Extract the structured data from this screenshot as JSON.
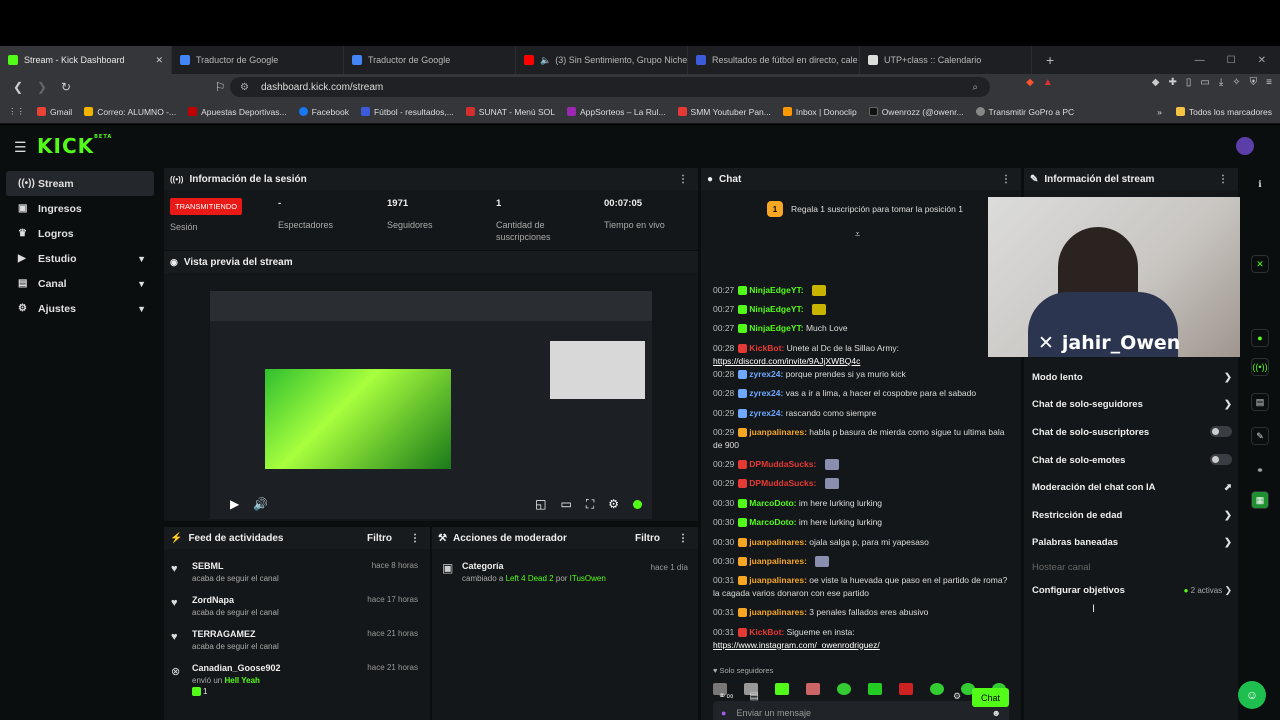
{
  "browser": {
    "tabs": [
      {
        "label": "Stream - Kick Dashboard",
        "color": "#53fc18",
        "active": true
      },
      {
        "label": "Traductor de Google",
        "color": "#4285f4"
      },
      {
        "label": "Traductor de Google",
        "color": "#4285f4"
      },
      {
        "label": "(3) Sin Sentimiento, Grupo Niche",
        "color": "#ff0000"
      },
      {
        "label": "Resultados de fútbol en directo, cale",
        "color": "#3b5bdb"
      },
      {
        "label": "UTP+class :: Calendario",
        "color": "#dddddd"
      }
    ],
    "url": "dashboard.kick.com/stream",
    "bookmarks": [
      {
        "label": "Gmail",
        "color": "#ea4335"
      },
      {
        "label": "Correo: ALUMNO -...",
        "color": "#f4b400"
      },
      {
        "label": "Apuestas Deportivas...",
        "color": "#c00000"
      },
      {
        "label": "Facebook",
        "color": "#1877f2"
      },
      {
        "label": "Fútbol - resultados,...",
        "color": "#3b5bdb"
      },
      {
        "label": "SUNAT - Menú SOL",
        "color": "#d32f2f"
      },
      {
        "label": "AppSorteos – La Rul...",
        "color": "#9c27b0"
      },
      {
        "label": "SMM Youtuber Pan...",
        "color": "#e53935"
      },
      {
        "label": "Inbox | Donoclip",
        "color": "#ff9800"
      },
      {
        "label": "Owenrozz (@owenr...",
        "color": "#111111"
      },
      {
        "label": "Transmitir GoPro a PC",
        "color": "#888888"
      }
    ],
    "bookmarks_all": "Todos los marcadores"
  },
  "sidebar": {
    "items": [
      {
        "label": "Stream",
        "icon": "broadcast-icon"
      },
      {
        "label": "Ingresos",
        "icon": "wallet-icon"
      },
      {
        "label": "Logros",
        "icon": "trophy-icon"
      },
      {
        "label": "Estudio",
        "icon": "studio-icon"
      },
      {
        "label": "Canal",
        "icon": "channel-icon"
      },
      {
        "label": "Ajustes",
        "icon": "gear-icon"
      }
    ]
  },
  "session": {
    "title": "Información de la sesión",
    "live": "TRANSMITIENDO",
    "session_label": "Sesión",
    "viewers": "-",
    "viewers_label": "Espectadores",
    "followers": "1971",
    "followers_label": "Seguidores",
    "subs": "1",
    "subs_label": "Cantidad de suscripciones",
    "uptime": "00:07:05",
    "uptime_label": "Tiempo en vivo"
  },
  "preview": {
    "title": "Vista previa del stream"
  },
  "feed": {
    "title": "Feed de actividades",
    "filter": "Filtro",
    "items": [
      {
        "name": "SEBML",
        "sub": "acaba de seguir el canal",
        "time": "hace 8 horas"
      },
      {
        "name": "ZordNapa",
        "sub": "acaba de seguir el canal",
        "time": "hace 17 horas"
      },
      {
        "name": "TERRAGAMEZ",
        "sub": "acaba de seguir el canal",
        "time": "hace 21 horas"
      },
      {
        "name": "Canadian_Goose902",
        "sub": "envió un",
        "gift": "Hell Yeah",
        "count": "1",
        "time": "hace 21 horas"
      }
    ]
  },
  "mod": {
    "title": "Acciones de moderador",
    "filter": "Filtro",
    "item_title": "Categoría",
    "item_pre": "cambiado a",
    "item_game": "Left 4 Dead 2",
    "item_by": "por",
    "item_user": "ITusOwen",
    "item_time": "hace 1 día"
  },
  "chat": {
    "title": "Chat",
    "pinned": "Regala 1 suscripción para tomar la posición 1",
    "messages": [
      {
        "time": "00:27",
        "user": "NinjaEdgeYT:",
        "color": "#53fc18",
        "text": ""
      },
      {
        "time": "00:27",
        "user": "NinjaEdgeYT:",
        "color": "#53fc18",
        "text": ""
      },
      {
        "time": "00:27",
        "user": "NinjaEdgeYT:",
        "color": "#53fc18",
        "text": "Much Love"
      },
      {
        "time": "00:28",
        "user": "KickBot:",
        "color": "#e53935",
        "text": "Unete al Dc de la Sillao Army:",
        "link": "https://discord.com/invite/9AJjXWBQ4c"
      },
      {
        "time": "00:28",
        "user": "zyrex24:",
        "color": "#6ea8ff",
        "text": "porque prendes si ya murio kick"
      },
      {
        "time": "00:28",
        "user": "zyrex24:",
        "color": "#6ea8ff",
        "text": "vas a ir a lima, a hacer el cospobre para el sabado"
      },
      {
        "time": "00:29",
        "user": "zyrex24:",
        "color": "#6ea8ff",
        "text": "rascando como siempre"
      },
      {
        "time": "00:29",
        "user": "juanpalinares:",
        "color": "#f5a623",
        "text": "habla p basura de mierda como sigue tu ultima bala de 900"
      },
      {
        "time": "00:29",
        "user": "DPMuddaSucks:",
        "color": "#e53935",
        "text": ""
      },
      {
        "time": "00:29",
        "user": "DPMuddaSucks:",
        "color": "#e53935",
        "text": ""
      },
      {
        "time": "00:30",
        "user": "MarcoDoto:",
        "color": "#53fc18",
        "text": "im here lurking lurking"
      },
      {
        "time": "00:30",
        "user": "MarcoDoto:",
        "color": "#53fc18",
        "text": "im here lurking lurking"
      },
      {
        "time": "00:30",
        "user": "juanpalinares:",
        "color": "#f5a623",
        "text": "ojala salga p, para mi yapesaso"
      },
      {
        "time": "00:30",
        "user": "juanpalinares:",
        "color": "#f5a623",
        "text": ""
      },
      {
        "time": "00:31",
        "user": "juanpalinares:",
        "color": "#f5a623",
        "text": "oe viste la huevada que paso en el partido de roma? la cagada varios donaron con ese partido"
      },
      {
        "time": "00:31",
        "user": "juanpalinares:",
        "color": "#f5a623",
        "text": "3 penales fallados eres abusivo"
      },
      {
        "time": "00:31",
        "user": "KickBot:",
        "color": "#e53935",
        "text": "Sigueme en insta:",
        "link": "https://www.instagram.com/_owenrodriguez/"
      }
    ],
    "mode": "Solo seguidores",
    "placeholder": "Enviar un mensaje",
    "send": "Chat"
  },
  "stream_info": {
    "title": "Información del stream",
    "camera_name": "jahir_Owen",
    "rows": [
      {
        "label": "Modo lento",
        "kind": "chevron"
      },
      {
        "label": "Chat de solo-seguidores",
        "kind": "chevron"
      },
      {
        "label": "Chat de solo-suscriptores",
        "kind": "toggle"
      },
      {
        "label": "Chat de solo-emotes",
        "kind": "toggle"
      },
      {
        "label": "Moderación del chat con IA",
        "kind": "chart"
      },
      {
        "label": "Restricción de edad",
        "kind": "chevron"
      },
      {
        "label": "Palabras baneadas",
        "kind": "chevron"
      },
      {
        "label": "Hostear canal",
        "kind": "disabled"
      },
      {
        "label": "Configurar objetivos",
        "kind": "goals",
        "extra": "2 activas"
      }
    ]
  },
  "colors": {
    "accent": "#53fc18",
    "live": "#e91916",
    "panel": "#141719",
    "bg": "#0b0e0f"
  }
}
